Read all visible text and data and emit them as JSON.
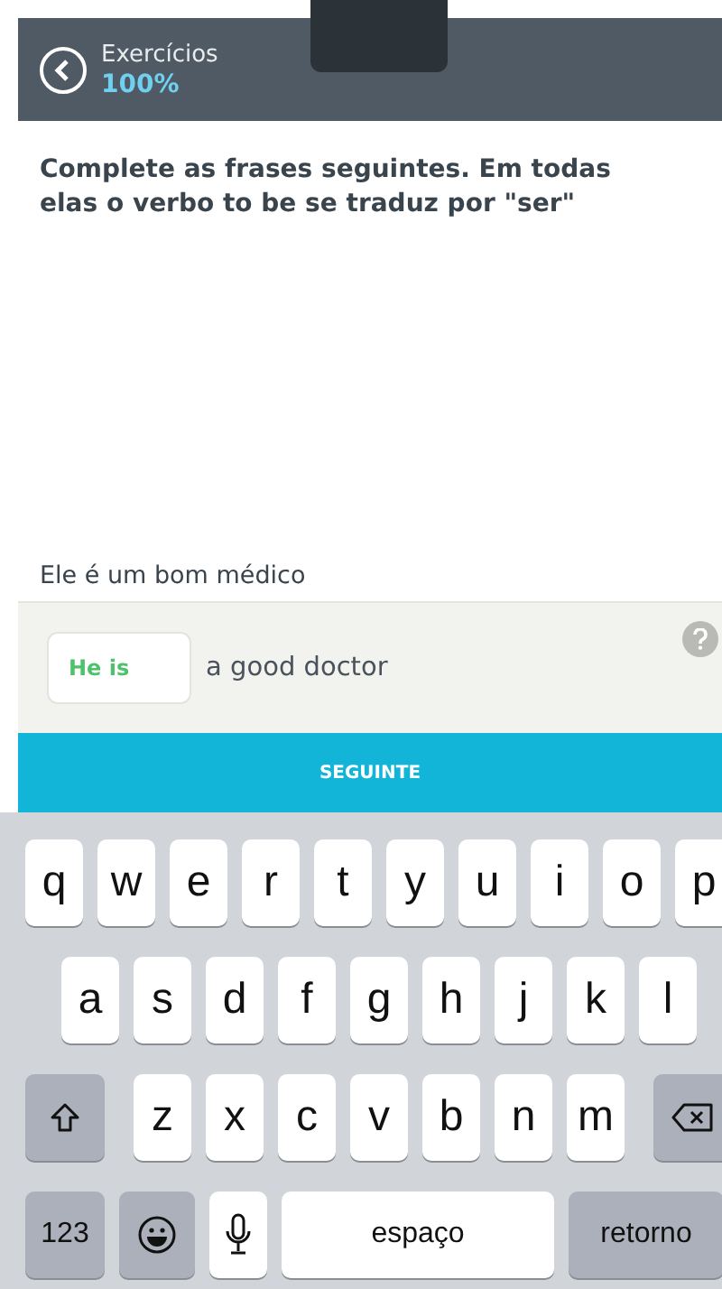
{
  "header": {
    "title": "Exercícios",
    "progress": "100%"
  },
  "instruction": "Complete as frases seguintes. Em todas elas o verbo to be se traduz por \"ser\"",
  "exercise": {
    "prompt": "Ele é um bom médico",
    "answer": "He is",
    "answer_correct": true,
    "rest": "a good doctor"
  },
  "next_button": "SEGUINTE",
  "keyboard": {
    "rows": [
      {
        "keys": [
          {
            "kind": "letter",
            "label": "q"
          },
          {
            "kind": "letter",
            "label": "w"
          },
          {
            "kind": "letter",
            "label": "e"
          },
          {
            "kind": "letter",
            "label": "r"
          },
          {
            "kind": "letter",
            "label": "t"
          },
          {
            "kind": "letter",
            "label": "y"
          },
          {
            "kind": "letter",
            "label": "u"
          },
          {
            "kind": "letter",
            "label": "i"
          },
          {
            "kind": "letter",
            "label": "o"
          },
          {
            "kind": "letter",
            "label": "p"
          }
        ]
      },
      {
        "keys": [
          {
            "kind": "letter",
            "label": "a"
          },
          {
            "kind": "letter",
            "label": "s"
          },
          {
            "kind": "letter",
            "label": "d"
          },
          {
            "kind": "letter",
            "label": "f"
          },
          {
            "kind": "letter",
            "label": "g"
          },
          {
            "kind": "letter",
            "label": "h"
          },
          {
            "kind": "letter",
            "label": "j"
          },
          {
            "kind": "letter",
            "label": "k"
          },
          {
            "kind": "letter",
            "label": "l"
          }
        ]
      },
      {
        "keys": [
          {
            "kind": "shift"
          },
          {
            "kind": "letter",
            "label": "z"
          },
          {
            "kind": "letter",
            "label": "x"
          },
          {
            "kind": "letter",
            "label": "c"
          },
          {
            "kind": "letter",
            "label": "v"
          },
          {
            "kind": "letter",
            "label": "b"
          },
          {
            "kind": "letter",
            "label": "n"
          },
          {
            "kind": "letter",
            "label": "m"
          },
          {
            "kind": "backspace"
          }
        ]
      },
      {
        "keys": [
          {
            "kind": "numbers",
            "label": "123"
          },
          {
            "kind": "emoji"
          },
          {
            "kind": "mic"
          },
          {
            "kind": "space",
            "label": "espaço"
          },
          {
            "kind": "return",
            "label": "retorno"
          }
        ]
      }
    ]
  }
}
